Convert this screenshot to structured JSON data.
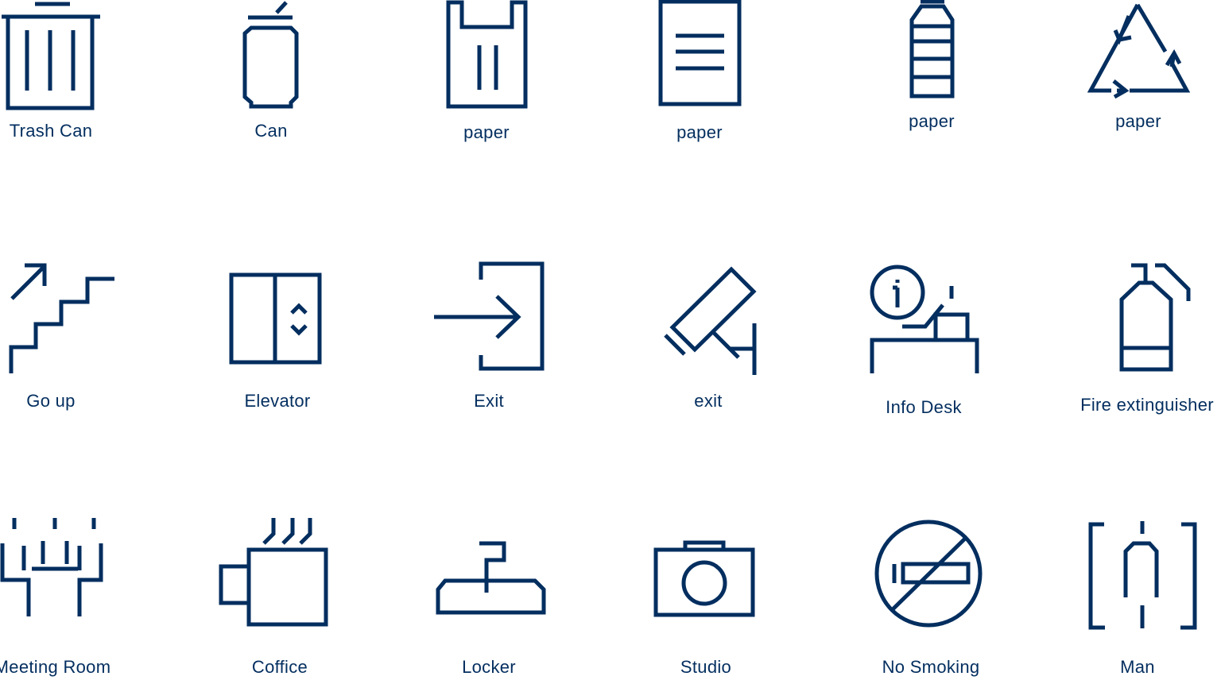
{
  "theme": {
    "icon_color": "#032e5f",
    "label_color": "#032e5f",
    "background": "#ffffff"
  },
  "icons": [
    {
      "icon": "trash-can-icon",
      "label": "Trash Can"
    },
    {
      "icon": "can-icon",
      "label": "Can"
    },
    {
      "icon": "plastic-bag-icon",
      "label": "paper"
    },
    {
      "icon": "paper-document-icon",
      "label": "paper"
    },
    {
      "icon": "bottle-icon",
      "label": "paper"
    },
    {
      "icon": "recycle-icon",
      "label": "paper"
    },
    {
      "icon": "stairs-up-icon",
      "label": "Go up"
    },
    {
      "icon": "elevator-icon",
      "label": "Elevator"
    },
    {
      "icon": "exit-arrow-icon",
      "label": "Exit"
    },
    {
      "icon": "security-camera-icon",
      "label": "exit"
    },
    {
      "icon": "info-desk-icon",
      "label": "Info Desk"
    },
    {
      "icon": "fire-extinguisher-icon",
      "label": "Fire extinguisher"
    },
    {
      "icon": "meeting-room-icon",
      "label": "Meeting Room"
    },
    {
      "icon": "coffee-cup-icon",
      "label": "Coffice"
    },
    {
      "icon": "locker-hanger-icon",
      "label": "Locker"
    },
    {
      "icon": "camera-icon",
      "label": "Studio"
    },
    {
      "icon": "no-smoking-icon",
      "label": "No Smoking"
    },
    {
      "icon": "man-restroom-icon",
      "label": "Man"
    }
  ]
}
